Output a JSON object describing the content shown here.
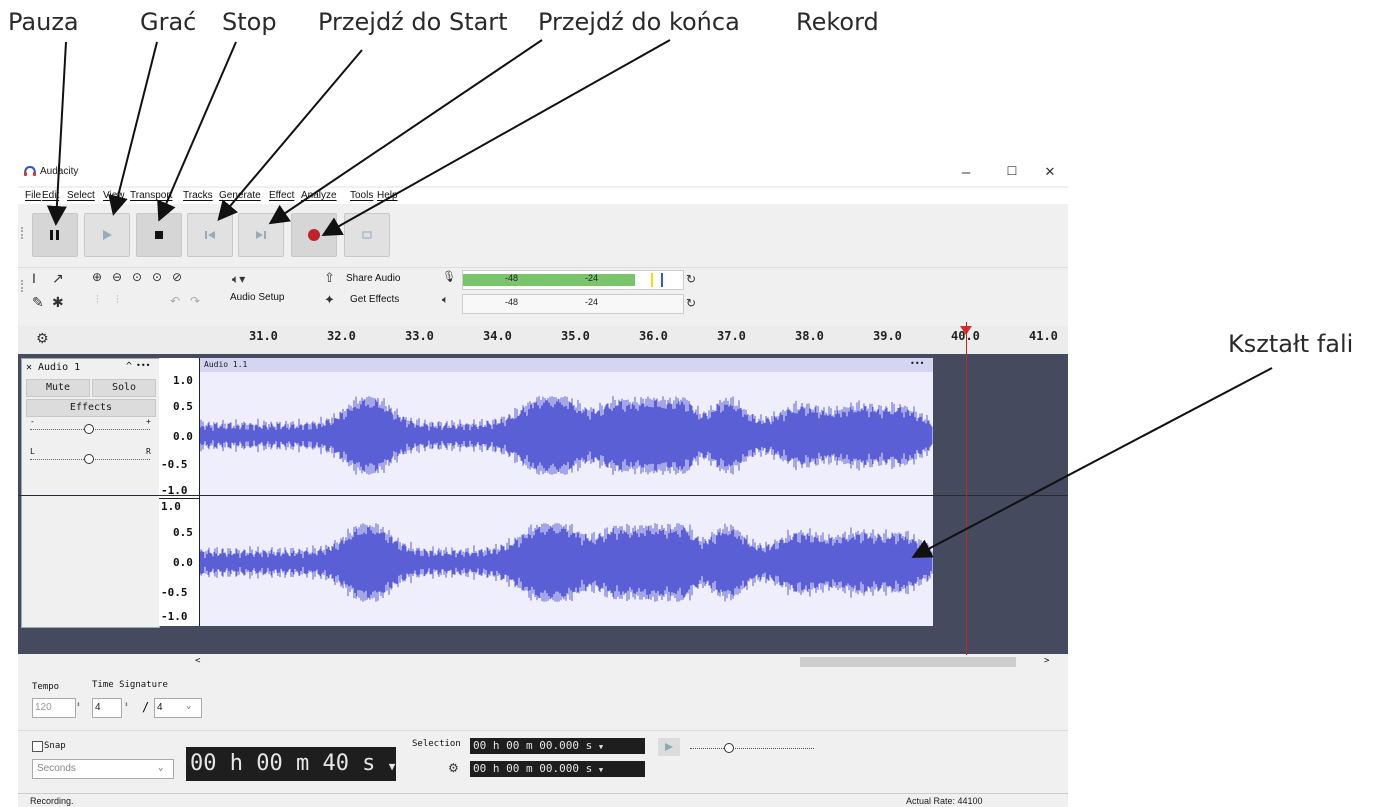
{
  "callouts": {
    "pause": "Pauza",
    "play": "Grać",
    "stop": "Stop",
    "skip_start": "Przejdź do Start",
    "skip_end": "Przejdź do końca",
    "record": "Rekord",
    "waveform": "Kształt fali"
  },
  "window": {
    "title": "Audacity",
    "minimize": "–",
    "maximize": "☐",
    "close": "✕"
  },
  "menu": [
    "File",
    "Edit",
    "Select",
    "View",
    "Transport",
    "Tracks",
    "Generate",
    "Effect",
    "Analyze",
    "Tools",
    "Help"
  ],
  "toolbar": {
    "audio_setup": "Audio Setup",
    "share_audio": "Share Audio",
    "get_effects": "Get Effects",
    "meter_rec_m48": "-48",
    "meter_rec_m24": "-24",
    "meter_play_m48": "-48",
    "meter_play_m24": "-24",
    "rec_level_fraction": 0.78
  },
  "ruler": {
    "ticks": [
      "31.0",
      "32.0",
      "33.0",
      "34.0",
      "35.0",
      "36.0",
      "37.0",
      "38.0",
      "39.0",
      "40.0",
      "41.0"
    ]
  },
  "track": {
    "name": "Audio 1",
    "mute": "Mute",
    "solo": "Solo",
    "effects": "Effects",
    "clip_name": "Audio 1.1",
    "clip_menu": "•••",
    "track_menu": "•••",
    "gain_minus": "-",
    "gain_plus": "+",
    "pan_left": "L",
    "pan_right": "R",
    "scale_top": [
      "1.0",
      "0.5",
      "0.0",
      "-0.5",
      "-1.0"
    ],
    "scale_bottom": [
      "1.0",
      "0.5",
      "0.0",
      "-0.5",
      "-1.0"
    ]
  },
  "lower": {
    "tempo_label": "Tempo",
    "time_sig_label": "Time Signature",
    "tempo_value": "120",
    "ts_num": "4",
    "ts_sep": "/",
    "ts_den": "4",
    "snap_label": "Snap",
    "snap_unit": "Seconds",
    "time_display": "00 h 00 m 40 s",
    "selection_label": "Selection",
    "sel_start": "00 h 00 m 00.000 s",
    "sel_end": "00 h 00 m 00.000 s"
  },
  "status": {
    "left": "Recording.",
    "right": "Actual Rate: 44100"
  }
}
